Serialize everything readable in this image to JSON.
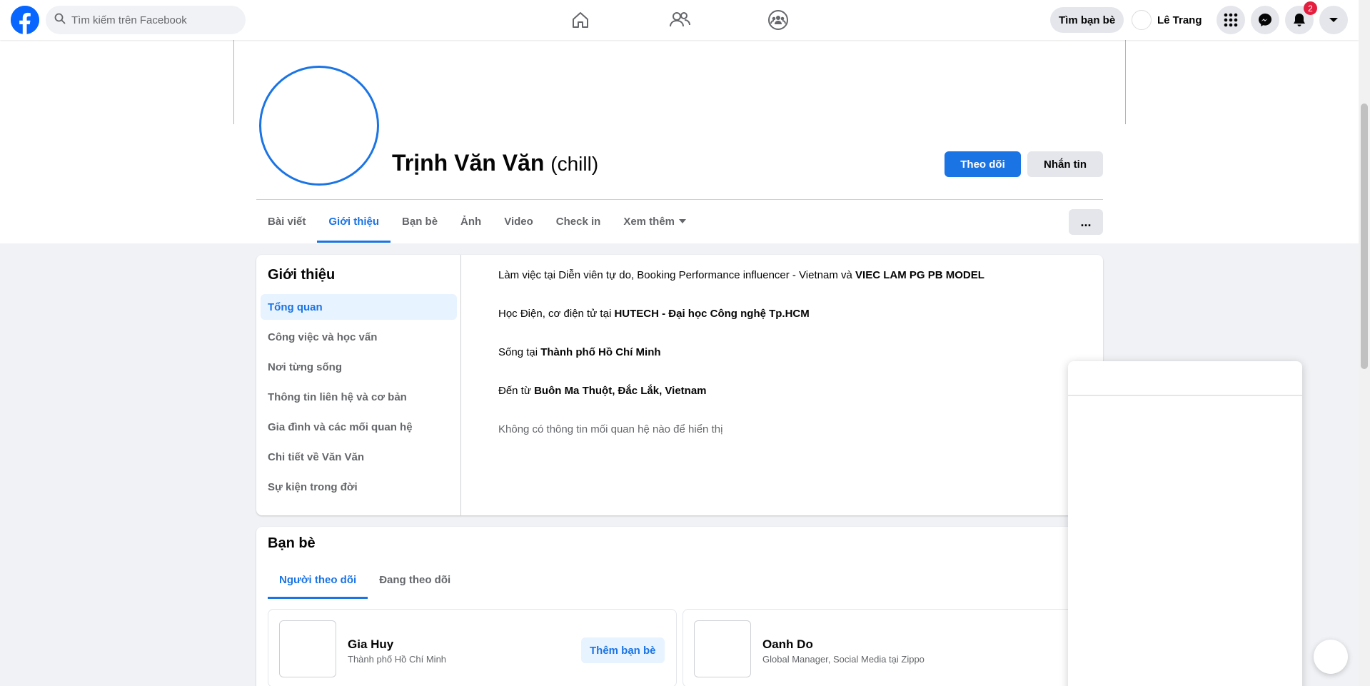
{
  "topbar": {
    "search_placeholder": "Tìm kiếm trên Facebook",
    "find_friends": "Tìm bạn bè",
    "user_name": "Lê Trang",
    "notification_count": "2"
  },
  "profile": {
    "name": "Trịnh Văn Văn",
    "nickname": "(chill)",
    "follow_label": "Theo dõi",
    "message_label": "Nhắn tin",
    "tabs": [
      {
        "label": "Bài viết"
      },
      {
        "label": "Giới thiệu"
      },
      {
        "label": "Bạn bè"
      },
      {
        "label": "Ảnh"
      },
      {
        "label": "Video"
      },
      {
        "label": "Check in"
      },
      {
        "label": "Xem thêm"
      }
    ],
    "more_label": "..."
  },
  "about": {
    "title": "Giới thiệu",
    "menu": [
      {
        "label": "Tổng quan"
      },
      {
        "label": "Công việc và học vấn"
      },
      {
        "label": "Nơi từng sống"
      },
      {
        "label": "Thông tin liên hệ và cơ bản"
      },
      {
        "label": "Gia đình và các mối quan hệ"
      },
      {
        "label": "Chi tiết về Văn Văn"
      },
      {
        "label": "Sự kiện trong đời"
      }
    ],
    "work_prefix": "Làm việc tại Diễn viên tự do, Booking Performance influencer - Vietnam và ",
    "work_bold": "VIEC LAM PG PB MODEL",
    "study_prefix": "Học Điện, cơ điện tử tại ",
    "study_bold": "HUTECH - Đại học Công nghệ Tp.HCM",
    "lives_prefix": "Sống tại ",
    "lives_bold": "Thành phố Hồ Chí Minh",
    "from_prefix": "Đến từ ",
    "from_bold": "Buôn Ma Thuột, Đắc Lắk, Vietnam",
    "relationship": "Không có thông tin mối quan hệ nào để hiển thị"
  },
  "friends": {
    "title": "Bạn bè",
    "tabs": [
      {
        "label": "Người theo dõi"
      },
      {
        "label": "Đang theo dõi"
      }
    ],
    "people": [
      {
        "name": "Gia Huy",
        "sub": "Thành phố Hồ Chí Minh",
        "add_label": "Thêm bạn bè"
      },
      {
        "name": "Oanh Do",
        "sub": "Global Manager, Social Media tại Zippo"
      }
    ]
  },
  "colors": {
    "accent": "#1b74e4",
    "badge": "#e41e3f",
    "background": "#f0f2f5"
  },
  "icons": [
    "facebook-logo-icon",
    "search-icon",
    "home-icon",
    "friends-icon",
    "groups-icon",
    "menu-grid-icon",
    "messenger-icon",
    "bell-icon",
    "caret-down-icon"
  ]
}
